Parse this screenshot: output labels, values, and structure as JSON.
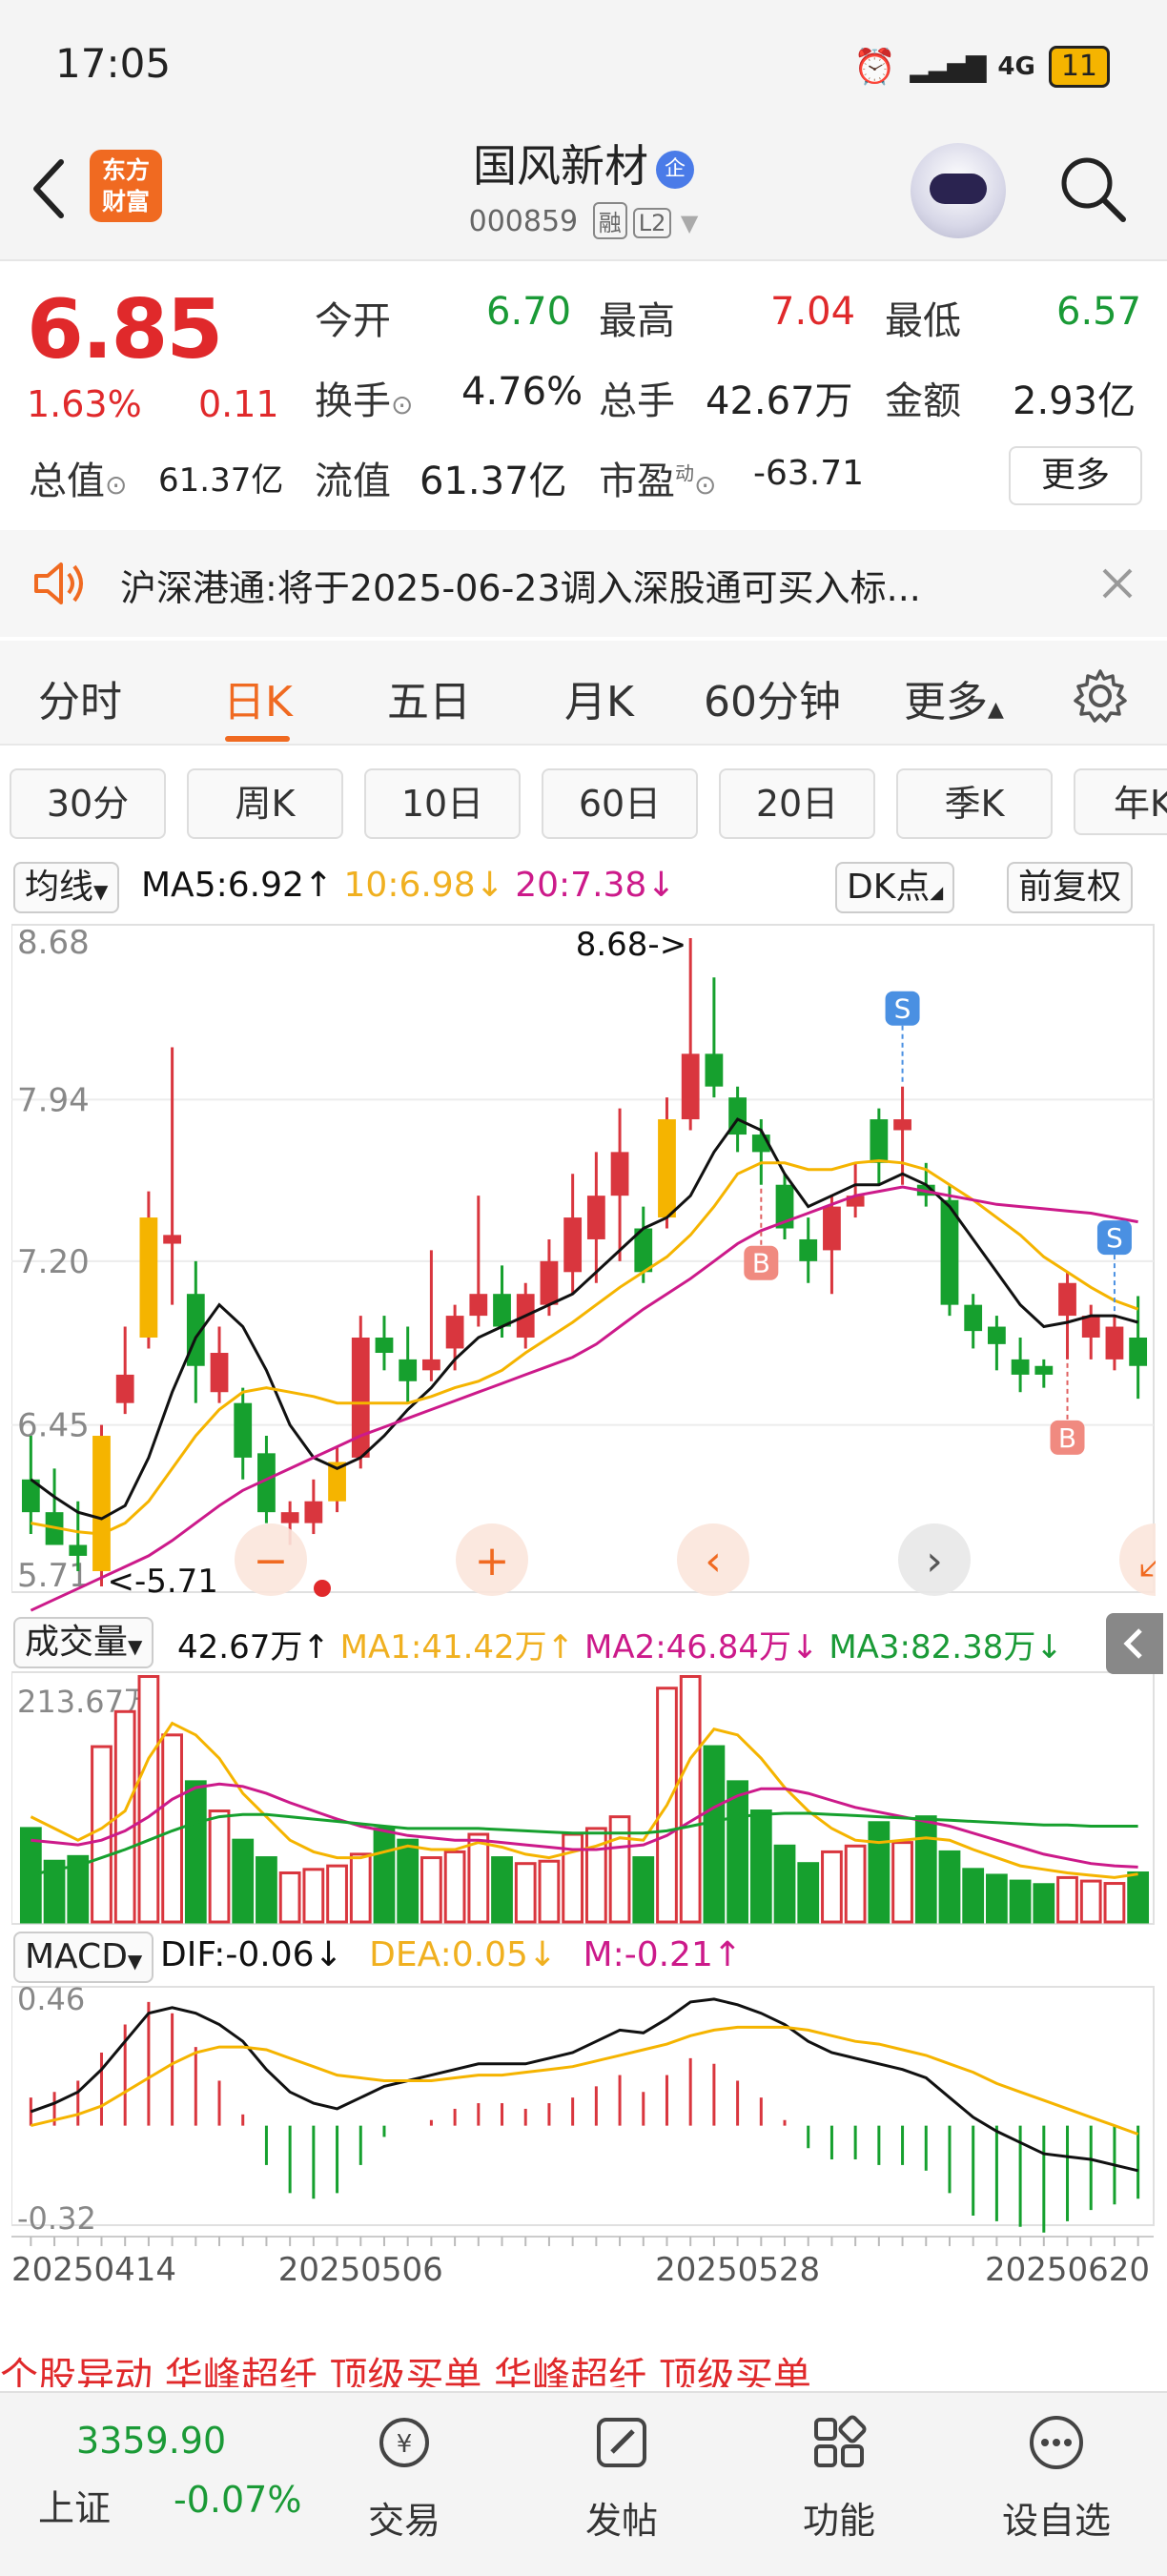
{
  "status": {
    "time": "17:05",
    "network": "4G",
    "battery": "11"
  },
  "header": {
    "title": "国风新材",
    "title_badge": "企",
    "code": "000859",
    "tag1": "融",
    "tag2": "L2",
    "logo_line1": "东方",
    "logo_line2": "财富"
  },
  "quote": {
    "price": "6.85",
    "change_pct": "1.63%",
    "change": "0.11",
    "open_label": "今开",
    "open": "6.70",
    "high_label": "最高",
    "high": "7.04",
    "low_label": "最低",
    "low": "6.57",
    "turnover_label": "换手",
    "turnover": "4.76%",
    "volume_label": "总手",
    "volume": "42.67万",
    "amount_label": "金额",
    "amount": "2.93亿",
    "mktcap_label": "总值",
    "mktcap": "61.37亿",
    "float_label": "流值",
    "float": "61.37亿",
    "pe_label": "市盈",
    "pe_sup": "动",
    "pe": "-63.71",
    "more": "更多"
  },
  "notice": {
    "text": "沪深港通:将于2025-06-23调入深股通可买入标..."
  },
  "tabs": [
    "分时",
    "日K",
    "五日",
    "月K",
    "60分钟",
    "更多"
  ],
  "subtabs": [
    "30分",
    "周K",
    "10日",
    "60日",
    "20日",
    "季K",
    "年K"
  ],
  "indicators": {
    "ma_chip": "均线",
    "ma5": "MA5:6.92",
    "ma10": "10:6.98",
    "ma20": "20:7.38",
    "dk": "DK点",
    "fq": "前复权",
    "vol_chip": "成交量",
    "vol": "42.67万",
    "vma1": "MA1:41.42万",
    "vma2": "MA2:46.84万",
    "vma3": "MA3:82.38万",
    "macd_chip": "MACD",
    "dif": "DIF:-0.06",
    "dea": "DEA:0.05",
    "m": "M:-0.21"
  },
  "chart_data": {
    "type": "candlestick",
    "price_axis_labels": [
      "8.68",
      "7.94",
      "7.20",
      "6.45",
      "5.71"
    ],
    "max_annotation": "8.68->",
    "min_annotation": "<-5.71",
    "volume_axis_label": "213.67万",
    "macd_axis_labels": [
      "0.46",
      "-0.32"
    ],
    "date_labels": [
      "20250414",
      "20250506",
      "20250528",
      "20250620"
    ],
    "candles": [
      {
        "o": 6.2,
        "h": 6.4,
        "l": 5.95,
        "c": 6.05
      },
      {
        "o": 6.05,
        "h": 6.25,
        "l": 5.9,
        "c": 5.9
      },
      {
        "o": 5.9,
        "h": 6.1,
        "l": 5.78,
        "c": 5.85
      },
      {
        "o": 5.78,
        "h": 6.45,
        "l": 5.71,
        "c": 6.4
      },
      {
        "o": 6.55,
        "h": 6.9,
        "l": 6.5,
        "c": 6.68
      },
      {
        "o": 6.85,
        "h": 7.52,
        "l": 6.8,
        "c": 7.4
      },
      {
        "o": 7.28,
        "h": 8.18,
        "l": 7.0,
        "c": 7.32
      },
      {
        "o": 7.05,
        "h": 7.2,
        "l": 6.55,
        "c": 6.72
      },
      {
        "o": 6.6,
        "h": 6.9,
        "l": 6.55,
        "c": 6.78
      },
      {
        "o": 6.55,
        "h": 6.62,
        "l": 6.2,
        "c": 6.3
      },
      {
        "o": 6.32,
        "h": 6.4,
        "l": 6.0,
        "c": 6.05
      },
      {
        "o": 6.0,
        "h": 6.1,
        "l": 5.9,
        "c": 6.05
      },
      {
        "o": 6.0,
        "h": 6.2,
        "l": 5.95,
        "c": 6.1
      },
      {
        "o": 6.1,
        "h": 6.35,
        "l": 6.05,
        "c": 6.28
      },
      {
        "o": 6.3,
        "h": 6.95,
        "l": 6.25,
        "c": 6.85
      },
      {
        "o": 6.85,
        "h": 6.95,
        "l": 6.7,
        "c": 6.78
      },
      {
        "o": 6.75,
        "h": 6.9,
        "l": 6.55,
        "c": 6.65
      },
      {
        "o": 6.7,
        "h": 7.25,
        "l": 6.65,
        "c": 6.75
      },
      {
        "o": 6.8,
        "h": 7.0,
        "l": 6.7,
        "c": 6.95
      },
      {
        "o": 6.95,
        "h": 7.5,
        "l": 6.9,
        "c": 7.05
      },
      {
        "o": 7.05,
        "h": 7.18,
        "l": 6.85,
        "c": 6.9
      },
      {
        "o": 6.85,
        "h": 7.1,
        "l": 6.8,
        "c": 7.05
      },
      {
        "o": 7.0,
        "h": 7.3,
        "l": 6.95,
        "c": 7.2
      },
      {
        "o": 7.15,
        "h": 7.6,
        "l": 7.05,
        "c": 7.4
      },
      {
        "o": 7.3,
        "h": 7.7,
        "l": 7.1,
        "c": 7.5
      },
      {
        "o": 7.5,
        "h": 7.9,
        "l": 7.2,
        "c": 7.7
      },
      {
        "o": 7.35,
        "h": 7.45,
        "l": 7.1,
        "c": 7.15
      },
      {
        "o": 7.4,
        "h": 7.95,
        "l": 7.35,
        "c": 7.85
      },
      {
        "o": 7.85,
        "h": 8.68,
        "l": 7.8,
        "c": 8.15
      },
      {
        "o": 8.15,
        "h": 8.5,
        "l": 7.95,
        "c": 8.0
      },
      {
        "o": 7.95,
        "h": 8.0,
        "l": 7.7,
        "c": 7.78
      },
      {
        "o": 7.78,
        "h": 7.85,
        "l": 7.55,
        "c": 7.7
      },
      {
        "o": 7.55,
        "h": 7.6,
        "l": 7.3,
        "c": 7.35
      },
      {
        "o": 7.3,
        "h": 7.4,
        "l": 7.1,
        "c": 7.2
      },
      {
        "o": 7.25,
        "h": 7.5,
        "l": 7.05,
        "c": 7.45
      },
      {
        "o": 7.45,
        "h": 7.65,
        "l": 7.4,
        "c": 7.5
      },
      {
        "o": 7.85,
        "h": 7.9,
        "l": 7.55,
        "c": 7.65
      },
      {
        "o": 7.8,
        "h": 8.0,
        "l": 7.55,
        "c": 7.85
      },
      {
        "o": 7.55,
        "h": 7.65,
        "l": 7.45,
        "c": 7.5
      },
      {
        "o": 7.48,
        "h": 7.55,
        "l": 6.95,
        "c": 7.0
      },
      {
        "o": 7.0,
        "h": 7.05,
        "l": 6.8,
        "c": 6.88
      },
      {
        "o": 6.9,
        "h": 6.95,
        "l": 6.7,
        "c": 6.82
      },
      {
        "o": 6.75,
        "h": 6.85,
        "l": 6.6,
        "c": 6.68
      },
      {
        "o": 6.72,
        "h": 6.75,
        "l": 6.62,
        "c": 6.68
      },
      {
        "o": 6.95,
        "h": 7.15,
        "l": 6.75,
        "c": 7.1
      },
      {
        "o": 6.85,
        "h": 7.0,
        "l": 6.75,
        "c": 6.95
      },
      {
        "o": 6.75,
        "h": 6.95,
        "l": 6.7,
        "c": 6.9
      },
      {
        "o": 6.85,
        "h": 7.04,
        "l": 6.57,
        "c": 6.72
      }
    ],
    "ma5": [
      6.2,
      6.12,
      6.05,
      6.02,
      6.08,
      6.3,
      6.6,
      6.85,
      7.0,
      6.9,
      6.7,
      6.45,
      6.3,
      6.25,
      6.3,
      6.4,
      6.52,
      6.62,
      6.75,
      6.85,
      6.9,
      6.95,
      7.0,
      7.05,
      7.15,
      7.25,
      7.35,
      7.4,
      7.5,
      7.7,
      7.85,
      7.8,
      7.6,
      7.45,
      7.5,
      7.55,
      7.55,
      7.6,
      7.55,
      7.45,
      7.3,
      7.15,
      7.0,
      6.9,
      6.92,
      6.95,
      6.95,
      6.92
    ],
    "ma10": [
      6.0,
      5.98,
      5.96,
      5.95,
      6.0,
      6.1,
      6.25,
      6.4,
      6.52,
      6.6,
      6.62,
      6.6,
      6.58,
      6.55,
      6.55,
      6.55,
      6.55,
      6.58,
      6.62,
      6.65,
      6.7,
      6.78,
      6.85,
      6.92,
      7.0,
      7.08,
      7.15,
      7.22,
      7.32,
      7.45,
      7.6,
      7.65,
      7.65,
      7.62,
      7.62,
      7.65,
      7.66,
      7.65,
      7.62,
      7.55,
      7.48,
      7.4,
      7.32,
      7.22,
      7.15,
      7.08,
      7.02,
      6.98
    ],
    "ma20": [
      5.6,
      5.65,
      5.7,
      5.75,
      5.8,
      5.85,
      5.92,
      6.0,
      6.08,
      6.15,
      6.2,
      6.25,
      6.3,
      6.35,
      6.4,
      6.44,
      6.48,
      6.52,
      6.56,
      6.6,
      6.64,
      6.68,
      6.72,
      6.76,
      6.82,
      6.9,
      6.98,
      7.05,
      7.12,
      7.2,
      7.28,
      7.34,
      7.38,
      7.42,
      7.46,
      7.5,
      7.52,
      7.54,
      7.52,
      7.5,
      7.48,
      7.46,
      7.45,
      7.44,
      7.43,
      7.42,
      7.4,
      7.38
    ],
    "signals": [
      {
        "i": 31,
        "type": "B"
      },
      {
        "i": 37,
        "type": "S"
      },
      {
        "i": 44,
        "type": "B"
      },
      {
        "i": 46,
        "type": "S"
      }
    ],
    "volume": [
      80,
      52,
      56,
      150,
      180,
      210,
      160,
      120,
      95,
      70,
      55,
      42,
      45,
      48,
      58,
      80,
      70,
      55,
      60,
      75,
      55,
      50,
      52,
      75,
      80,
      90,
      55,
      200,
      210,
      150,
      120,
      95,
      65,
      50,
      60,
      65,
      85,
      68,
      90,
      60,
      45,
      40,
      35,
      32,
      38,
      35,
      33,
      42
    ],
    "vma1": [
      90,
      80,
      70,
      80,
      95,
      140,
      170,
      160,
      140,
      110,
      90,
      70,
      60,
      55,
      55,
      60,
      65,
      62,
      62,
      68,
      64,
      58,
      55,
      60,
      65,
      72,
      70,
      100,
      140,
      165,
      160,
      140,
      115,
      95,
      80,
      70,
      68,
      70,
      72,
      70,
      62,
      55,
      48,
      45,
      42,
      40,
      38,
      41
    ],
    "vma2": [
      70,
      68,
      66,
      70,
      78,
      90,
      105,
      115,
      118,
      116,
      110,
      102,
      95,
      88,
      82,
      78,
      74,
      72,
      70,
      70,
      68,
      66,
      64,
      62,
      62,
      64,
      66,
      74,
      86,
      98,
      108,
      114,
      114,
      110,
      104,
      98,
      94,
      90,
      86,
      82,
      76,
      70,
      64,
      58,
      54,
      50,
      48,
      47
    ],
    "vma3": [
      40,
      45,
      48,
      55,
      62,
      70,
      78,
      85,
      90,
      92,
      92,
      90,
      88,
      86,
      84,
      82,
      80,
      80,
      80,
      80,
      79,
      78,
      77,
      76,
      76,
      76,
      76,
      78,
      82,
      86,
      90,
      92,
      93,
      93,
      92,
      91,
      90,
      89,
      88,
      87,
      86,
      85,
      84,
      83,
      83,
      82,
      82,
      82
    ],
    "dif": [
      0.05,
      0.08,
      0.12,
      0.2,
      0.3,
      0.4,
      0.42,
      0.4,
      0.36,
      0.3,
      0.2,
      0.12,
      0.08,
      0.06,
      0.1,
      0.14,
      0.16,
      0.18,
      0.2,
      0.22,
      0.22,
      0.22,
      0.24,
      0.26,
      0.3,
      0.34,
      0.33,
      0.38,
      0.44,
      0.45,
      0.43,
      0.4,
      0.36,
      0.3,
      0.26,
      0.24,
      0.22,
      0.2,
      0.17,
      0.1,
      0.03,
      -0.02,
      -0.06,
      -0.1,
      -0.11,
      -0.12,
      -0.14,
      -0.16
    ],
    "dea": [
      0.0,
      0.02,
      0.04,
      0.07,
      0.12,
      0.17,
      0.22,
      0.26,
      0.28,
      0.28,
      0.27,
      0.24,
      0.21,
      0.18,
      0.17,
      0.16,
      0.16,
      0.16,
      0.17,
      0.18,
      0.18,
      0.19,
      0.2,
      0.21,
      0.23,
      0.25,
      0.27,
      0.29,
      0.32,
      0.34,
      0.35,
      0.35,
      0.35,
      0.34,
      0.32,
      0.3,
      0.29,
      0.27,
      0.25,
      0.22,
      0.19,
      0.15,
      0.12,
      0.09,
      0.06,
      0.03,
      0.0,
      -0.03
    ],
    "macd_m": [
      0.1,
      0.12,
      0.16,
      0.26,
      0.36,
      0.44,
      0.4,
      0.28,
      0.16,
      0.04,
      -0.14,
      -0.24,
      -0.26,
      -0.24,
      -0.14,
      -0.04,
      0.0,
      0.02,
      0.06,
      0.08,
      0.08,
      0.06,
      0.08,
      0.1,
      0.14,
      0.18,
      0.12,
      0.18,
      0.24,
      0.22,
      0.16,
      0.1,
      0.02,
      -0.08,
      -0.12,
      -0.12,
      -0.14,
      -0.14,
      -0.16,
      -0.24,
      -0.32,
      -0.34,
      -0.36,
      -0.38,
      -0.34,
      -0.3,
      -0.28,
      -0.26
    ]
  },
  "news": {
    "text": "个股异动 华峰超纤 顶级买单 华峰超纤 顶级买单"
  },
  "bottom": {
    "index_value": "3359.90",
    "index_name": "上证",
    "index_change": "-0.07%",
    "nav": [
      "交易",
      "发帖",
      "功能",
      "设自选"
    ]
  }
}
